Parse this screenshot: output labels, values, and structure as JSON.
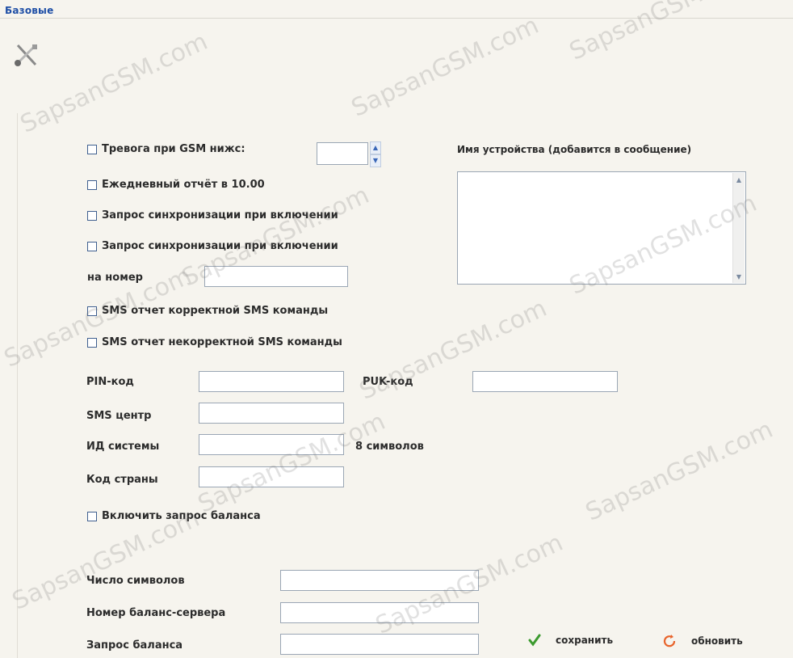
{
  "header": {
    "tab_label": "Базовые"
  },
  "left": {
    "gsm_alarm_label": "Тревога при GSM нижс:",
    "daily_report_label": "Ежедневный отчёт в 10.00",
    "sync_request_label_1": "Запрос синхронизации при включении",
    "sync_request_label_2": "Запрос синхронизации при включении",
    "number_label": "на номер",
    "sms_correct_label": "SMS отчет корректной SMS команды",
    "sms_incorrect_label": "SMS отчет некорректной SMS команды",
    "pin_label": "PIN-код",
    "puk_label": "PUK-код",
    "sms_center_label": "SMS центр",
    "system_id_label": "ИД системы",
    "system_id_hint": "8 символов",
    "country_code_label": "Код страны",
    "balance_request_enable_label": "Включить запрос баланса",
    "symbol_count_label": "Число символов",
    "balance_server_label": "Номер баланс-сервера",
    "balance_request_label": "Запрос баланса"
  },
  "right": {
    "device_name_label": "Имя устройства (добавится в сообщение)"
  },
  "actions": {
    "save_label": "сохранить",
    "refresh_label": "обновить"
  },
  "watermark": "SapsanGSM.com",
  "colors": {
    "background": "#f6f4ee",
    "tab_text": "#1f4fa6",
    "input_border": "#9aa6b4",
    "save_icon": "#3b9a2e",
    "refresh_icon": "#e8632a"
  },
  "icons": {
    "tools": "tools-icon",
    "save": "checkmark-icon",
    "refresh": "refresh-icon"
  }
}
